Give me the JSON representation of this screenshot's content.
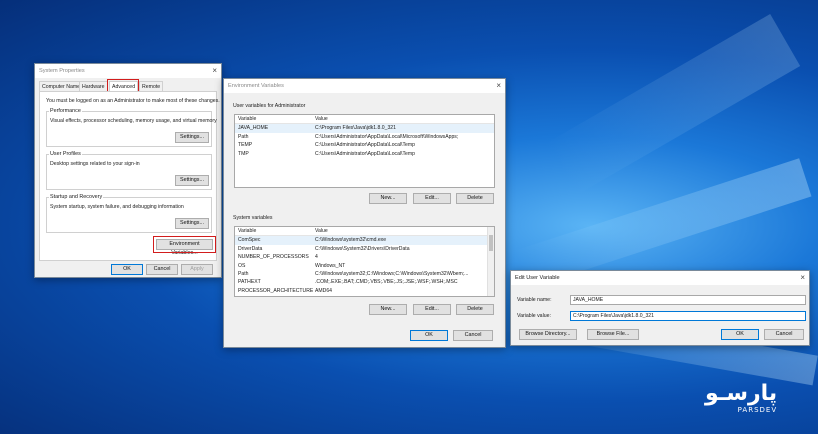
{
  "system_properties": {
    "title": "System Properties",
    "tabs": [
      "Computer Name",
      "Hardware",
      "Advanced",
      "Remote"
    ],
    "notice": "You must be logged on as an Administrator to make most of these changes.",
    "performance": {
      "title": "Performance",
      "desc": "Visual effects, processor scheduling, memory usage, and virtual memory",
      "button": "Settings..."
    },
    "user_profiles": {
      "title": "User Profiles",
      "desc": "Desktop settings related to your sign-in",
      "button": "Settings..."
    },
    "startup": {
      "title": "Startup and Recovery",
      "desc": "System startup, system failure, and debugging information",
      "button": "Settings..."
    },
    "env_button": "Environment Variables...",
    "ok": "OK",
    "cancel": "Cancel",
    "apply": "Apply"
  },
  "env_vars": {
    "title": "Environment Variables",
    "user_section": "User variables for Administrator",
    "col_variable": "Variable",
    "col_value": "Value",
    "user_rows": [
      {
        "name": "JAVA_HOME",
        "value": "C:\\Program Files\\Java\\jdk1.8.0_321"
      },
      {
        "name": "Path",
        "value": "C:\\Users\\Administrator\\AppData\\Local\\Microsoft\\WindowsApps;"
      },
      {
        "name": "TEMP",
        "value": "C:\\Users\\Administrator\\AppData\\Local\\Temp"
      },
      {
        "name": "TMP",
        "value": "C:\\Users\\Administrator\\AppData\\Local\\Temp"
      }
    ],
    "system_section": "System variables",
    "system_rows": [
      {
        "name": "ComSpec",
        "value": "C:\\Windows\\system32\\cmd.exe"
      },
      {
        "name": "DriverData",
        "value": "C:\\Windows\\System32\\Drivers\\DriverData"
      },
      {
        "name": "NUMBER_OF_PROCESSORS",
        "value": "4"
      },
      {
        "name": "OS",
        "value": "Windows_NT"
      },
      {
        "name": "Path",
        "value": "C:\\Windows\\system32;C:\\Windows;C:\\Windows\\System32\\Wbem;..."
      },
      {
        "name": "PATHEXT",
        "value": ".COM;.EXE;.BAT;.CMD;.VBS;.VBE;.JS;.JSE;.WSF;.WSH;.MSC"
      },
      {
        "name": "PROCESSOR_ARCHITECTURE",
        "value": "AMD64"
      }
    ],
    "new": "New...",
    "edit": "Edit...",
    "delete": "Delete",
    "ok": "OK",
    "cancel": "Cancel"
  },
  "edit_user_var": {
    "title": "Edit User Variable",
    "name_label": "Variable name:",
    "name_value": "JAVA_HOME",
    "value_label": "Variable value:",
    "value_value": "C:\\Program Files\\Java\\jdk1.8.0_321",
    "browse_dir": "Browse Directory...",
    "browse_file": "Browse File...",
    "ok": "OK",
    "cancel": "Cancel"
  },
  "watermark": {
    "brand": "پارسـو",
    "sub": "PARSDEV"
  }
}
